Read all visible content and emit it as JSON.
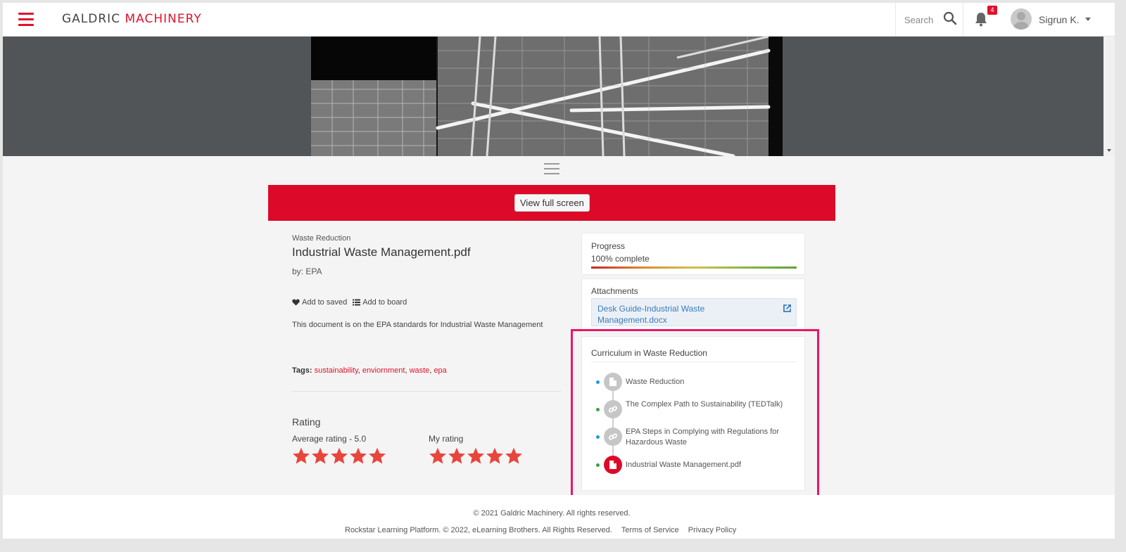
{
  "header": {
    "logo_part1": "GALDRIC ",
    "logo_part2": "MACHINERY",
    "search_label": "Search",
    "notification_count": "4",
    "user_name": "Sigrun K."
  },
  "viewer": {
    "full_screen_label": "View full screen"
  },
  "document": {
    "category": "Waste Reduction",
    "title": "Industrial Waste Management.pdf",
    "author": "by: EPA",
    "add_saved": "Add to saved",
    "add_board": "Add to board",
    "description": "This document is on the EPA standards for Industrial Waste Management",
    "tags_label": "Tags:",
    "tags": [
      "sustainability",
      "enviornment",
      "waste",
      "epa"
    ]
  },
  "rating": {
    "title": "Rating",
    "average_label": "Average rating - 5.0",
    "my_label": "My rating",
    "average_stars": 5,
    "my_stars": 5,
    "max_stars": 5
  },
  "progress": {
    "title": "Progress",
    "text": "100% complete",
    "value": 1.0
  },
  "attachments": {
    "title": "Attachments",
    "file": "Desk Guide-Industrial Waste Management.docx"
  },
  "curriculum": {
    "title": "Curriculum in Waste Reduction",
    "items": [
      {
        "label": "Waste Reduction",
        "icon": "document-icon",
        "dot": "#1a9be0"
      },
      {
        "label": "The Complex Path to Sustainability (TEDTalk)",
        "icon": "link-icon",
        "dot": "#3aa33a"
      },
      {
        "label": "EPA Steps in Complying with Regulations for Hazardous Waste",
        "icon": "link-icon",
        "dot": "#1a9be0"
      },
      {
        "label": "Industrial Waste Management.pdf",
        "icon": "document-icon",
        "dot": "#3aa33a"
      }
    ]
  },
  "footer": {
    "copyright": "© 2021 Galdric Machinery. All rights reserved.",
    "platform": "Rockstar Learning Platform. © 2022, eLearning Brothers. All Rights Reserved.",
    "terms": "Terms of Service",
    "privacy": "Privacy Policy"
  },
  "colors": {
    "brand_red": "#dc0a28",
    "highlight_pink": "#ec1562",
    "star": "#e8453c",
    "link_blue": "#3d7cb8"
  }
}
